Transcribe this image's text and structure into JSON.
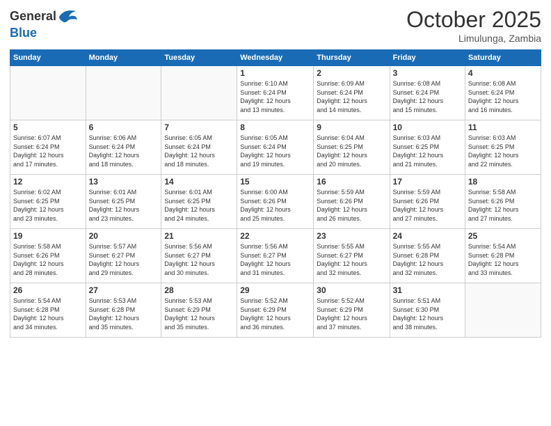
{
  "header": {
    "logo_general": "General",
    "logo_blue": "Blue",
    "month": "October 2025",
    "location": "Limulunga, Zambia"
  },
  "days_of_week": [
    "Sunday",
    "Monday",
    "Tuesday",
    "Wednesday",
    "Thursday",
    "Friday",
    "Saturday"
  ],
  "weeks": [
    [
      {
        "day": "",
        "info": ""
      },
      {
        "day": "",
        "info": ""
      },
      {
        "day": "",
        "info": ""
      },
      {
        "day": "1",
        "info": "Sunrise: 6:10 AM\nSunset: 6:24 PM\nDaylight: 12 hours\nand 13 minutes."
      },
      {
        "day": "2",
        "info": "Sunrise: 6:09 AM\nSunset: 6:24 PM\nDaylight: 12 hours\nand 14 minutes."
      },
      {
        "day": "3",
        "info": "Sunrise: 6:08 AM\nSunset: 6:24 PM\nDaylight: 12 hours\nand 15 minutes."
      },
      {
        "day": "4",
        "info": "Sunrise: 6:08 AM\nSunset: 6:24 PM\nDaylight: 12 hours\nand 16 minutes."
      }
    ],
    [
      {
        "day": "5",
        "info": "Sunrise: 6:07 AM\nSunset: 6:24 PM\nDaylight: 12 hours\nand 17 minutes."
      },
      {
        "day": "6",
        "info": "Sunrise: 6:06 AM\nSunset: 6:24 PM\nDaylight: 12 hours\nand 18 minutes."
      },
      {
        "day": "7",
        "info": "Sunrise: 6:05 AM\nSunset: 6:24 PM\nDaylight: 12 hours\nand 18 minutes."
      },
      {
        "day": "8",
        "info": "Sunrise: 6:05 AM\nSunset: 6:24 PM\nDaylight: 12 hours\nand 19 minutes."
      },
      {
        "day": "9",
        "info": "Sunrise: 6:04 AM\nSunset: 6:25 PM\nDaylight: 12 hours\nand 20 minutes."
      },
      {
        "day": "10",
        "info": "Sunrise: 6:03 AM\nSunset: 6:25 PM\nDaylight: 12 hours\nand 21 minutes."
      },
      {
        "day": "11",
        "info": "Sunrise: 6:03 AM\nSunset: 6:25 PM\nDaylight: 12 hours\nand 22 minutes."
      }
    ],
    [
      {
        "day": "12",
        "info": "Sunrise: 6:02 AM\nSunset: 6:25 PM\nDaylight: 12 hours\nand 23 minutes."
      },
      {
        "day": "13",
        "info": "Sunrise: 6:01 AM\nSunset: 6:25 PM\nDaylight: 12 hours\nand 23 minutes."
      },
      {
        "day": "14",
        "info": "Sunrise: 6:01 AM\nSunset: 6:25 PM\nDaylight: 12 hours\nand 24 minutes."
      },
      {
        "day": "15",
        "info": "Sunrise: 6:00 AM\nSunset: 6:26 PM\nDaylight: 12 hours\nand 25 minutes."
      },
      {
        "day": "16",
        "info": "Sunrise: 5:59 AM\nSunset: 6:26 PM\nDaylight: 12 hours\nand 26 minutes."
      },
      {
        "day": "17",
        "info": "Sunrise: 5:59 AM\nSunset: 6:26 PM\nDaylight: 12 hours\nand 27 minutes."
      },
      {
        "day": "18",
        "info": "Sunrise: 5:58 AM\nSunset: 6:26 PM\nDaylight: 12 hours\nand 27 minutes."
      }
    ],
    [
      {
        "day": "19",
        "info": "Sunrise: 5:58 AM\nSunset: 6:26 PM\nDaylight: 12 hours\nand 28 minutes."
      },
      {
        "day": "20",
        "info": "Sunrise: 5:57 AM\nSunset: 6:27 PM\nDaylight: 12 hours\nand 29 minutes."
      },
      {
        "day": "21",
        "info": "Sunrise: 5:56 AM\nSunset: 6:27 PM\nDaylight: 12 hours\nand 30 minutes."
      },
      {
        "day": "22",
        "info": "Sunrise: 5:56 AM\nSunset: 6:27 PM\nDaylight: 12 hours\nand 31 minutes."
      },
      {
        "day": "23",
        "info": "Sunrise: 5:55 AM\nSunset: 6:27 PM\nDaylight: 12 hours\nand 32 minutes."
      },
      {
        "day": "24",
        "info": "Sunrise: 5:55 AM\nSunset: 6:28 PM\nDaylight: 12 hours\nand 32 minutes."
      },
      {
        "day": "25",
        "info": "Sunrise: 5:54 AM\nSunset: 6:28 PM\nDaylight: 12 hours\nand 33 minutes."
      }
    ],
    [
      {
        "day": "26",
        "info": "Sunrise: 5:54 AM\nSunset: 6:28 PM\nDaylight: 12 hours\nand 34 minutes."
      },
      {
        "day": "27",
        "info": "Sunrise: 5:53 AM\nSunset: 6:28 PM\nDaylight: 12 hours\nand 35 minutes."
      },
      {
        "day": "28",
        "info": "Sunrise: 5:53 AM\nSunset: 6:29 PM\nDaylight: 12 hours\nand 35 minutes."
      },
      {
        "day": "29",
        "info": "Sunrise: 5:52 AM\nSunset: 6:29 PM\nDaylight: 12 hours\nand 36 minutes."
      },
      {
        "day": "30",
        "info": "Sunrise: 5:52 AM\nSunset: 6:29 PM\nDaylight: 12 hours\nand 37 minutes."
      },
      {
        "day": "31",
        "info": "Sunrise: 5:51 AM\nSunset: 6:30 PM\nDaylight: 12 hours\nand 38 minutes."
      },
      {
        "day": "",
        "info": ""
      }
    ]
  ]
}
